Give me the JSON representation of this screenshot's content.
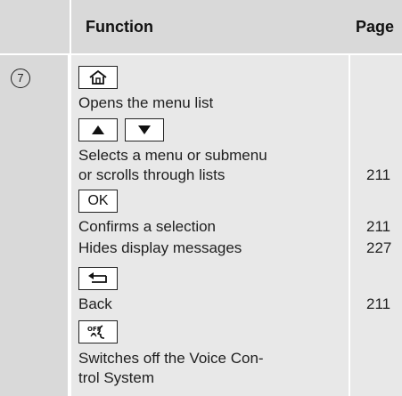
{
  "header": {
    "function_label": "Function",
    "page_label": "Page"
  },
  "row": {
    "number": "7",
    "keys": {
      "home_key_icon": "home-icon",
      "up_key_icon": "triangle-up-icon",
      "down_key_icon": "triangle-down-icon",
      "ok_key_label": "OK",
      "back_key_icon": "back-arrow-icon",
      "voice_off_key_label": "OFF"
    },
    "lines": {
      "opens_menu": "Opens the menu list",
      "selects_line1": "Selects a menu or submenu",
      "selects_line2": "or scrolls through lists",
      "confirms": "Confirms a selection",
      "hides": "Hides display messages",
      "back": "Back",
      "switches_line1": "Switches off the Voice Con-",
      "switches_line2": "trol System"
    },
    "pages": {
      "selects": "211",
      "confirms": "211",
      "hides": "227",
      "back": "211"
    }
  }
}
